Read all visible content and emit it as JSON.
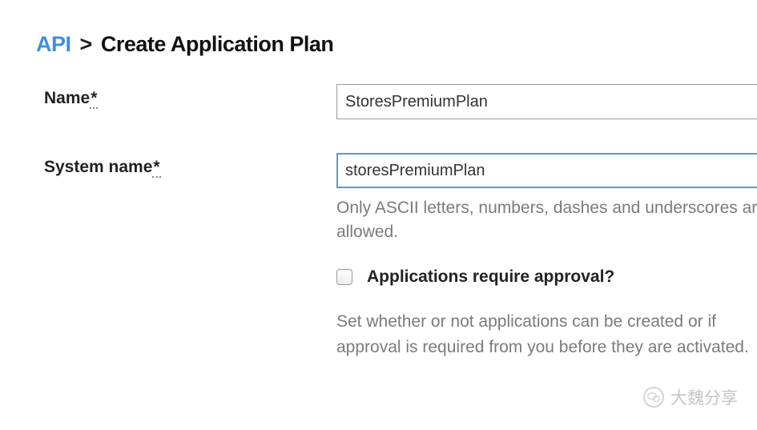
{
  "breadcrumb": {
    "root": "API",
    "separator": ">",
    "current": "Create Application Plan"
  },
  "form": {
    "name": {
      "label": "Name",
      "required_mark": "*",
      "value": "StoresPremiumPlan"
    },
    "system_name": {
      "label": "System name",
      "required_mark": "*",
      "value": "storesPremiumPlan",
      "hint": "Only ASCII letters, numbers, dashes and underscores are allowed."
    },
    "approval": {
      "checked": false,
      "label": "Applications require approval?",
      "description": "Set whether or not applications can be created or if approval is required from you before they are activated."
    }
  },
  "watermark": {
    "text": "大魏分享"
  }
}
